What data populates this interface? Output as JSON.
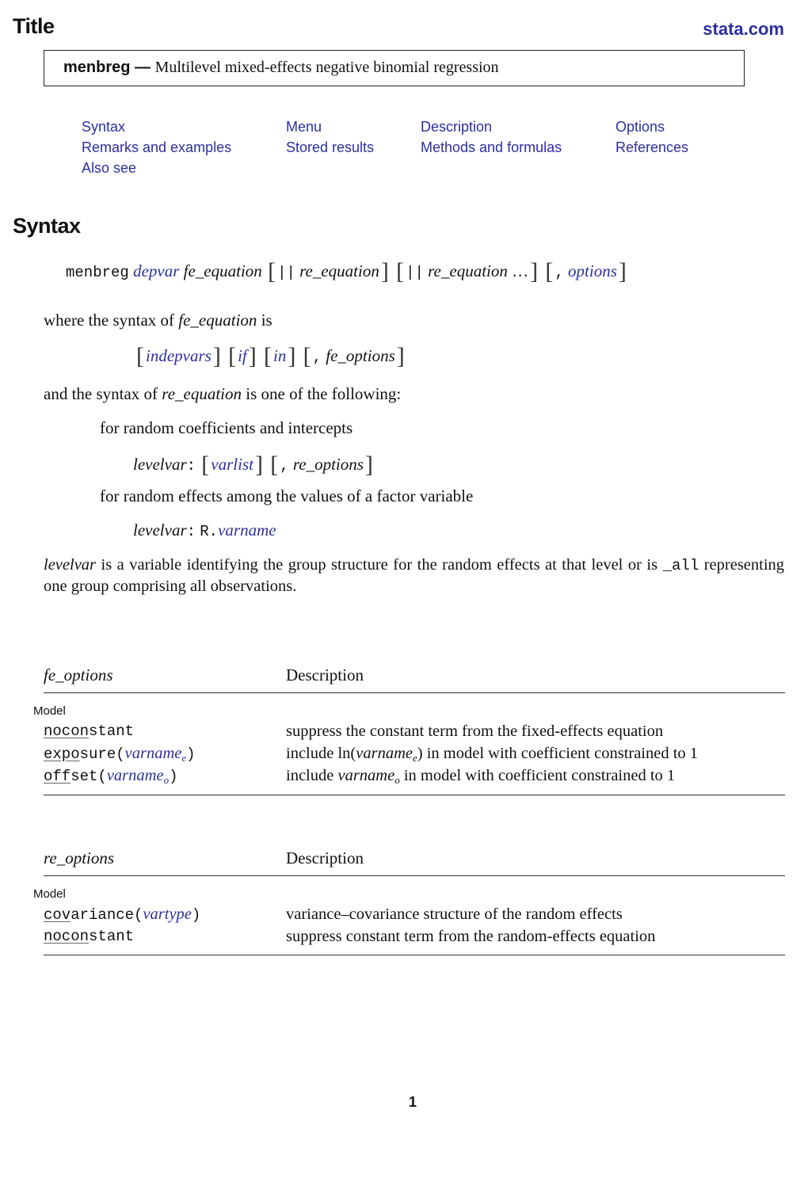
{
  "header": {
    "title": "Title",
    "site_link": "stata.com",
    "command": "menbreg —",
    "command_description": "Multilevel mixed-effects negative binomial regression"
  },
  "nav": {
    "links": [
      "Syntax",
      "Menu",
      "Description",
      "Options",
      "Remarks and examples",
      "Stored results",
      "Methods and formulas",
      "References",
      "Also see"
    ]
  },
  "syntax": {
    "heading": "Syntax",
    "main": {
      "cmd": "menbreg",
      "depvar": "depvar",
      "fe_equation": "fe_equation",
      "bars": "||",
      "re_equation": "re_equation",
      "ellipsis": "…",
      "comma": ",",
      "options": "options"
    },
    "where_line": {
      "prefix": "where the syntax of",
      "term": "fe_equation",
      "suffix": "is"
    },
    "fe_syntax": {
      "indepvars": "indepvars",
      "if": "if",
      "in": "in",
      "comma": ",",
      "fe_options": "fe_options"
    },
    "and_line": {
      "prefix": "and the syntax of",
      "term": "re_equation",
      "suffix": "is one of the following:"
    },
    "random_coef": {
      "label": "for random coefficients and intercepts",
      "levelvar": "levelvar",
      "colon": ":",
      "varlist": "varlist",
      "comma": ",",
      "re_options": "re_options"
    },
    "random_factor": {
      "label": "for random effects among the values of a factor variable",
      "levelvar": "levelvar",
      "colon": ":",
      "rprefix": "R.",
      "varname": "varname"
    },
    "levelvar_note": {
      "term": "levelvar",
      "text": "is a variable identifying the group structure for the random effects at that level or is",
      "all": "_all",
      "text2": "representing one group comprising all observations."
    }
  },
  "fe_table": {
    "col1_header": "fe_options",
    "col2_header": "Description",
    "group": "Model",
    "rows": [
      {
        "ul": "nocon",
        "rest": "stant",
        "arg": "",
        "sub": "",
        "desc": "suppress the constant term from the fixed-effects equation"
      },
      {
        "ul": "expo",
        "rest": "sure(",
        "arg": "varname",
        "sub": "e",
        "close": ")",
        "desc_pre": "include  ln(",
        "desc_arg": "varname",
        "desc_sub": "e",
        "desc_post": ")  in model with coefficient constrained to 1"
      },
      {
        "ul": "off",
        "rest": "set(",
        "arg": "varname",
        "sub": "o",
        "close": ")",
        "desc_pre": "include ",
        "desc_arg": "varname",
        "desc_sub": "o",
        "desc_post": "  in model with coefficient constrained to 1"
      }
    ]
  },
  "re_table": {
    "col1_header": "re_options",
    "col2_header": "Description",
    "group": "Model",
    "rows": [
      {
        "ul": "cov",
        "rest": "ariance(",
        "arg": "vartype",
        "close": ")",
        "desc": "variance–covariance structure of the random effects"
      },
      {
        "ul": "nocon",
        "rest": "stant",
        "desc": "suppress constant term from the random-effects equation"
      }
    ]
  },
  "footer": {
    "page_number": "1"
  },
  "colors": {
    "link": "#2b2fa0",
    "text": "#111111",
    "rule": "#333333"
  }
}
